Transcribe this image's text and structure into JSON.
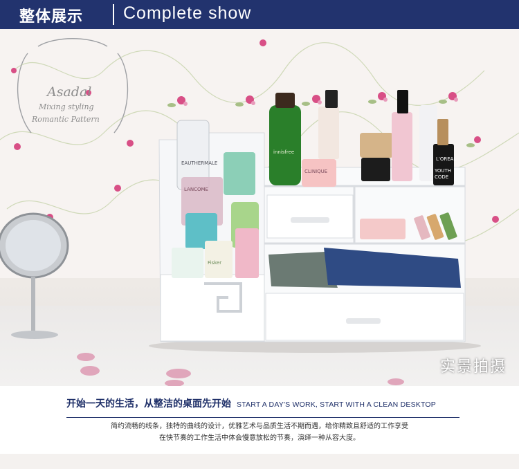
{
  "header": {
    "title_cn": "整体展示",
    "title_en": "Complete show"
  },
  "watermark": {
    "brand": "Asadal",
    "line1": "Mixing styling",
    "line2": "Romantic Pattern"
  },
  "photo": {
    "caption": "实景拍摄",
    "product_labels": [
      "Lancome",
      "innisfree",
      "YOUTH CODE",
      "L'OREAL",
      "CLINIQUE",
      "Fisker"
    ],
    "colors": {
      "board": "#ffffff",
      "accent_pink": "#d84f86",
      "bottle_green": "#2a7f2a"
    }
  },
  "intro": {
    "heading_cn": "开始一天的生活，从整洁的桌面先开始",
    "heading_en": "START A DAY'S WORK, START WITH A CLEAN DESKTOP",
    "line1": "简约流畅的线条，独特的曲线的设计，优雅艺术与品质生活不期而遇，给你精致且舒适的工作享受",
    "line2": "在快节奏的工作生活中体会慢意放松的节奏，演绎一种从容大度。"
  }
}
